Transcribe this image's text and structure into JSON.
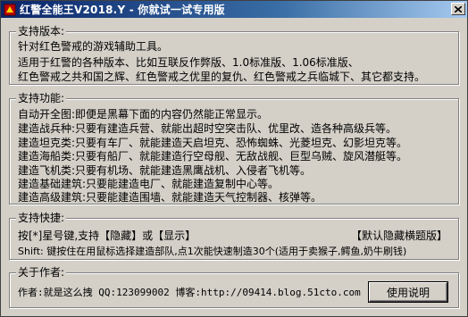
{
  "window": {
    "title": "红警全能王V2018.Y - 你就试一试专用版",
    "icon": "app-icon",
    "close_symbol": "✕"
  },
  "support_version": {
    "title": "支持版本:",
    "lines": [
      "针对红色警戒的游戏辅助工具。",
      "适用于红警的各种版本、比如互联反作弊版、1.0标准版、1.06标准版、",
      "红色警戒之共和国之辉、红色警戒之优里的复仇、红色警戒之兵临城下、其它都支持。"
    ]
  },
  "support_features": {
    "title": "支持功能:",
    "lines": [
      "自动开全图:即便是黑幕下面的内容仍然能正常显示。",
      "建造战兵种:只要有建造兵营、就能出超时空突击队、优里改、造各种高级兵等。",
      "建造坦克类:只要有车厂、就能建造天启坦克、恐怖蜘蛛、光菱坦克、幻影坦克等。",
      "建造海船类:只要有船厂、就能建造行空母舰、无敌战舰、巨型乌贼、旋风潜艇等。",
      "建造飞机类:只要有机场、就能建造黑鹰战机、入侵者飞机等。",
      "建造基础建筑:只要能建造电厂、就能建造复制中心等。",
      "建造高级建筑:只要能建造围墙、就能建造天气控制器、核弹等。"
    ]
  },
  "hotkeys": {
    "title": "支持快捷:",
    "line1": "按[*]星号键,支持【隐藏】或【显示】",
    "line1_right": "【默认隐藏横题版】",
    "line2": "Shift: 键按住在用鼠标选择建造部队,点1次能快速制造30个(适用于卖猴子,鳄鱼,奶牛刷钱)"
  },
  "about": {
    "title": "关于作者:",
    "line": "作者:就是这么拽 QQ:123099002 博客:http://09414.blog.51cto.com",
    "usage_button": "使用说明"
  },
  "colors": {
    "face": "#d4d0c8",
    "title_start": "#0a246a",
    "title_end": "#a6caf0"
  }
}
